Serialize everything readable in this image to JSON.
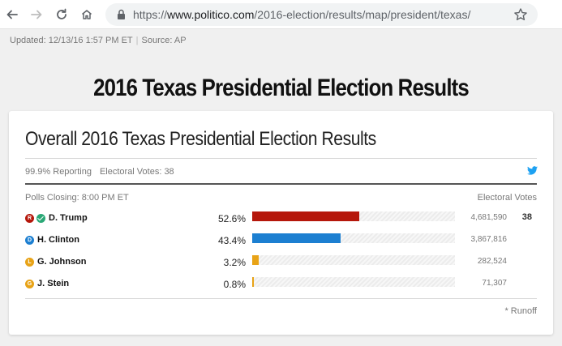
{
  "browser": {
    "url_scheme": "https://",
    "url_host": "www.politico.com",
    "url_path": "/2016-election/results/map/president/texas/",
    "back_icon": "arrow-left-icon",
    "forward_icon": "arrow-right-icon",
    "reload_icon": "reload-icon",
    "lock_icon": "lock-icon",
    "bookmark_icon": "star-icon"
  },
  "page": {
    "updated": "Updated: 12/13/16 1:57 PM ET",
    "source": "Source: AP",
    "title": "2016 Texas Presidential Election Results"
  },
  "card": {
    "title": "Overall 2016 Texas Presidential Election Results",
    "reporting": "99.9% Reporting",
    "electoral_votes": "Electoral Votes: 38",
    "share_icon": "twitter-icon",
    "polls_closing": "Polls Closing: 8:00 PM ET",
    "ev_header": "Electoral Votes",
    "runoff_note": "* Runoff"
  },
  "candidates": [
    {
      "name": "D. Trump",
      "party_letter": "R",
      "party_color": "#b5170b",
      "winner": true,
      "pct": "52.6%",
      "share": 0.526,
      "votes": "4,681,590",
      "ev": "38",
      "bar_color": "#b5170b"
    },
    {
      "name": "H. Clinton",
      "party_letter": "D",
      "party_color": "#1c7fd1",
      "winner": false,
      "pct": "43.4%",
      "share": 0.434,
      "votes": "3,867,816",
      "ev": "",
      "bar_color": "#1c7fd1"
    },
    {
      "name": "G. Johnson",
      "party_letter": "L",
      "party_color": "#e8a317",
      "winner": false,
      "pct": "3.2%",
      "share": 0.032,
      "votes": "282,524",
      "ev": "",
      "bar_color": "#e8a317"
    },
    {
      "name": "J. Stein",
      "party_letter": "G",
      "party_color": "#e8a317",
      "winner": false,
      "pct": "0.8%",
      "share": 0.008,
      "votes": "71,307",
      "ev": "",
      "bar_color": "#e8a317"
    }
  ]
}
